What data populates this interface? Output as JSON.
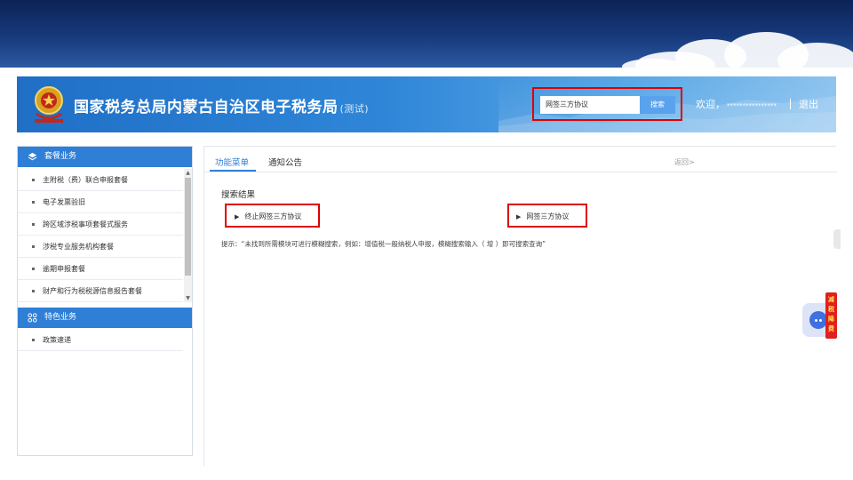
{
  "header": {
    "site_title": "国家税务总局内蒙古自治区电子税务局",
    "site_title_suffix": "(测试)",
    "search_value": "网签三方协议",
    "search_button": "搜索",
    "welcome_text": "欢迎，",
    "user_masked": "****************",
    "logout": "退出"
  },
  "sidebar": {
    "section1_title": "套餐业务",
    "section1_items": [
      "主附税（费）联合申报套餐",
      "电子发票验旧",
      "跨区域涉税事项套餐式服务",
      "涉税专业服务机构套餐",
      "逾期申报套餐",
      "财产和行为税税源信息报告套餐"
    ],
    "section2_title": "特色业务",
    "section2_items": [
      "政策速递"
    ]
  },
  "main": {
    "tabs": [
      "功能菜单",
      "通知公告"
    ],
    "back_link": "返回>",
    "results_title": "搜索结果",
    "results": [
      "终止网签三方协议",
      "网签三方协议"
    ],
    "hint": "提示：“未找到所需模块可进行模糊搜索，例如：增值税一般纳税人申报，模糊搜索输入（ 增 ）即可搜索查询”"
  },
  "widgets": {
    "feedback_chars": [
      "减",
      "税",
      "降",
      "费"
    ]
  },
  "colors": {
    "primary": "#2f7fd6",
    "highlight": "#e00000",
    "banner_dark": "#0c2356"
  }
}
